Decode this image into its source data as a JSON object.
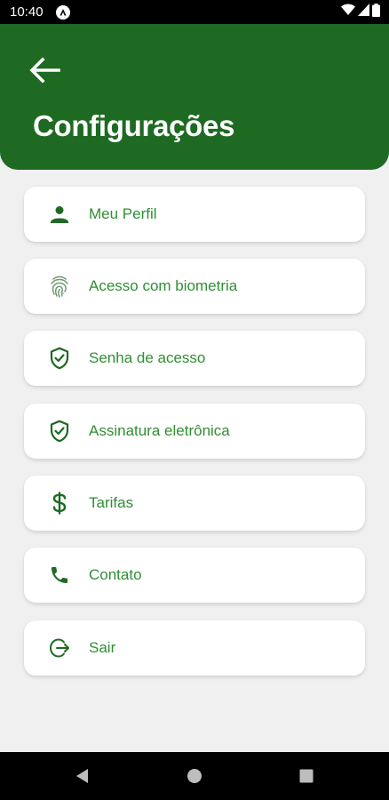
{
  "status_bar": {
    "time": "10:40",
    "icons": [
      "app-notification-icon",
      "wifi-icon",
      "cellular-signal-icon",
      "battery-icon"
    ]
  },
  "header": {
    "title": "Configurações",
    "back_icon": "arrow-left-icon",
    "background": "#1e6a23"
  },
  "menu": {
    "items": [
      {
        "label": "Meu Perfil",
        "icon": "person-icon"
      },
      {
        "label": "Acesso com biometria",
        "icon": "fingerprint-icon"
      },
      {
        "label": "Senha de acesso",
        "icon": "shield-check-icon"
      },
      {
        "label": "Assinatura eletrônica",
        "icon": "shield-check-icon"
      },
      {
        "label": "Tarifas",
        "icon": "dollar-icon"
      },
      {
        "label": "Contato",
        "icon": "phone-icon"
      },
      {
        "label": "Sair",
        "icon": "logout-icon"
      }
    ],
    "icon_color": "#1e6a23",
    "label_color": "#2f8f32"
  },
  "nav_bar": {
    "icons": [
      "back-triangle-icon",
      "home-circle-icon",
      "recents-square-icon"
    ]
  }
}
